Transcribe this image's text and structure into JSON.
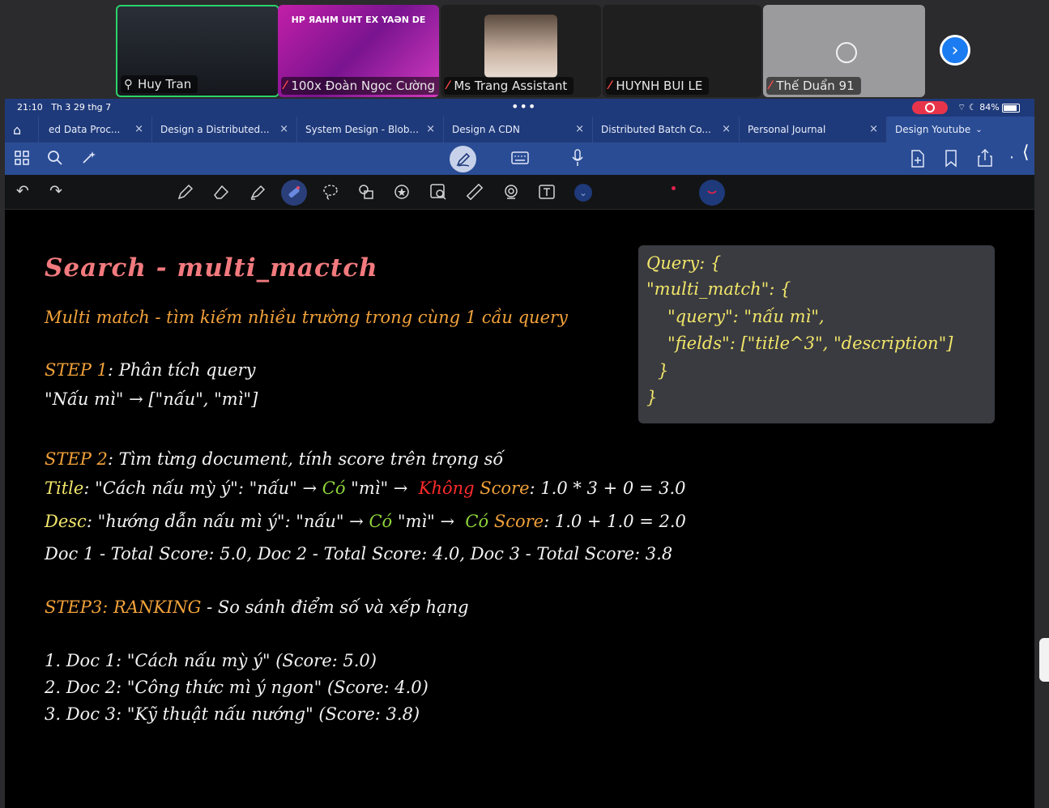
{
  "participants": [
    {
      "name": "Huy Tran",
      "muted": false,
      "active_speaker": true
    },
    {
      "name": "100x Đoàn Ngọc Cường",
      "muted": true,
      "banner": "HP ЯAHM UHT EX YAƏN DE"
    },
    {
      "name": "Ms Trang Assistant",
      "muted": true
    },
    {
      "name": "HUYNH BUI LE",
      "muted": true
    },
    {
      "name": "Thế Duẩn 91",
      "muted": true
    }
  ],
  "status_bar": {
    "time": "21:10",
    "date": "Th 3 29 thg 7",
    "battery": "84%"
  },
  "tabs": [
    {
      "label": "ed Data Proc..."
    },
    {
      "label": "Design a Distributed..."
    },
    {
      "label": "System Design - Blob..."
    },
    {
      "label": "Design A CDN"
    },
    {
      "label": "Distributed Batch Co..."
    },
    {
      "label": "Personal Journal"
    },
    {
      "label": "Design Youtube",
      "active": true
    }
  ],
  "note": {
    "title": "Search - multi_mactch",
    "subtitle": "Multi match - tìm kiếm nhiều trường trong cùng 1 cầu query",
    "step1_label": "STEP 1",
    "step1_text": ": Phân tích query",
    "step1_example": "\"Nấu mì\" → [\"nấu\", \"mì\"]",
    "step2_label": "STEP 2",
    "step2_text": ": Tìm từng document, tính score trên trọng số",
    "title_line": {
      "label": "Title",
      "p1": ": \"Cách nấu mỳ ý\": \"nấu\" → ",
      "co": "Có",
      "p2": " \"mì\" → ",
      "khong": "Không",
      "score": " Score",
      "p3": ": 1.0 * 3 + 0 = 3.0"
    },
    "desc_line": {
      "label": "Desc",
      "p1": ": \"hướng dẫn nấu mì ý\": \"nấu\" → ",
      "co1": "Có",
      "p2": " \"mì\" → ",
      "co2": "Có",
      "score": " Score",
      "p3": ": 1.0  + 1.0 = 2.0"
    },
    "totals": "Doc 1 - Total Score: 5.0, Doc 2 - Total Score: 4.0, Doc 3 - Total Score: 3.8",
    "step3_label": "STEP3: RANKING",
    "step3_text": " - So sánh điểm số và xếp hạng",
    "ranking": [
      "1. Doc 1: \"Cách nấu mỳ ý\" (Score: 5.0)",
      "2. Doc 2: \"Công thức mì ý ngon\" (Score: 4.0)",
      "3. Doc 3: \"Kỹ thuật nấu nướng\" (Score: 3.8)"
    ],
    "code": [
      "Query: {",
      "\"multi_match\": {",
      "\"query\": \"nấu mì\",",
      "\"fields\": [\"title^3\", \"description\"]",
      "}",
      "}"
    ]
  }
}
